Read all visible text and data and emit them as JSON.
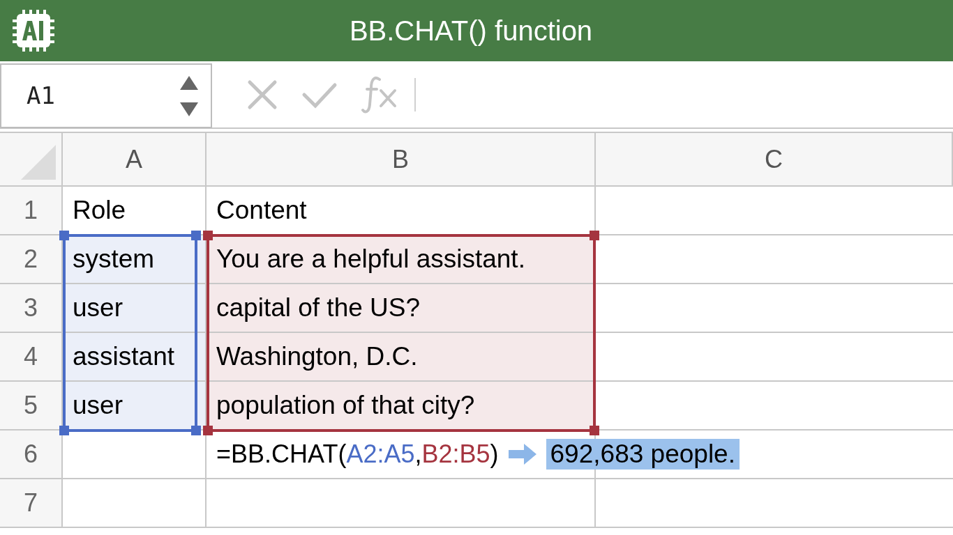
{
  "window": {
    "title": "BB.CHAT() function"
  },
  "formula_bar": {
    "name_box": "A1"
  },
  "columns": [
    {
      "label": "A",
      "color": "#4a6cc6"
    },
    {
      "label": "B",
      "color": "#a5343f"
    },
    {
      "label": "C"
    }
  ],
  "rows": [
    {
      "number": "1",
      "a": "Role",
      "b": "Content",
      "in_range": false
    },
    {
      "number": "2",
      "a": "system",
      "b": "You are a helpful assistant.",
      "in_range": true
    },
    {
      "number": "3",
      "a": "user",
      "b": "capital of the US?",
      "in_range": true
    },
    {
      "number": "4",
      "a": "assistant",
      "b": "Washington, D.C.",
      "in_range": true
    },
    {
      "number": "5",
      "a": "user",
      "b": "population of that city?",
      "in_range": true
    },
    {
      "number": "6",
      "formula": [
        {
          "text": "=BB.CHAT(",
          "color": "#000000"
        },
        {
          "text": "A2:A5",
          "color": "#4a6cc6"
        },
        {
          "text": ",",
          "color": "#000000"
        },
        {
          "text": "B2:B5",
          "color": "#a5343f"
        },
        {
          "text": ")",
          "color": "#000000"
        }
      ],
      "result": "692,683 people.",
      "in_range": false
    },
    {
      "number": "7",
      "in_range": false
    }
  ]
}
